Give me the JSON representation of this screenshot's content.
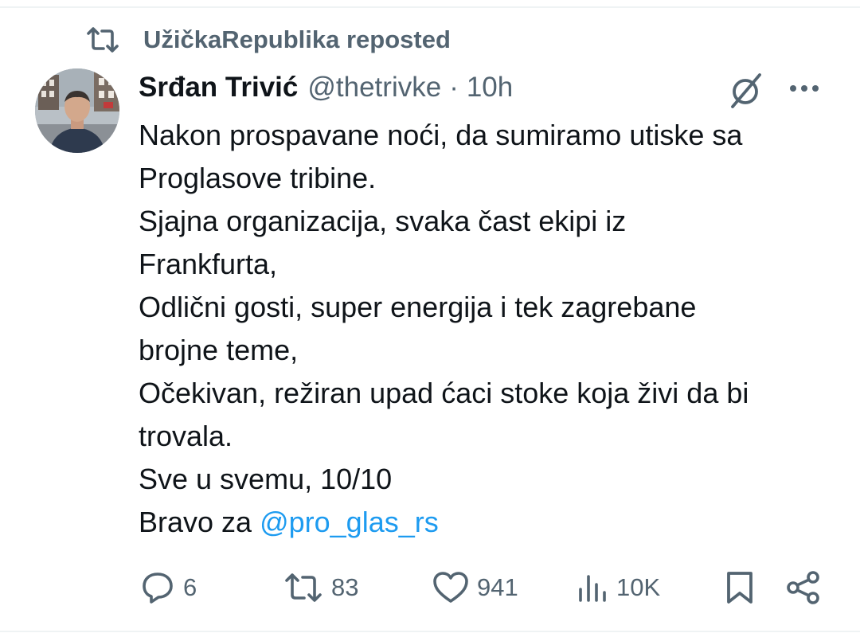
{
  "repost": {
    "icon": "repost-icon",
    "label": "UžičkaRepublika reposted"
  },
  "tweet": {
    "author": {
      "name": "Srđan Trivić",
      "handle": "@thetrivke",
      "avatar": "avatar-photo"
    },
    "separator": "·",
    "time": "10h",
    "header_icons": [
      "grok-icon",
      "more-icon"
    ],
    "lines": [
      "Nakon prospavane noći, da sumiramo utiske sa",
      "Proglasove tribine.",
      "Sjajna organizacija, svaka čast ekipi iz",
      "Frankfurta,",
      "Odlični gosti, super energija i tek zagrebane",
      "brojne teme,",
      "Očekivan, režiran upad ćaci stoke koja živi da bi",
      "trovala.",
      "Sve u svemu, 10/10"
    ],
    "last_line_prefix": "Bravo za ",
    "mention": "@pro_glas_rs"
  },
  "actions": {
    "reply": {
      "icon": "reply-icon",
      "count": "6"
    },
    "repost": {
      "icon": "repost-icon",
      "count": "83"
    },
    "like": {
      "icon": "heart-icon",
      "count": "941"
    },
    "views": {
      "icon": "views-icon",
      "count": "10K"
    },
    "bookmark": {
      "icon": "bookmark-icon"
    },
    "share": {
      "icon": "share-icon"
    }
  },
  "colors": {
    "text": "#0f1419",
    "secondary": "#536471",
    "link": "#1d9bf0",
    "divider": "#eff3f4"
  }
}
